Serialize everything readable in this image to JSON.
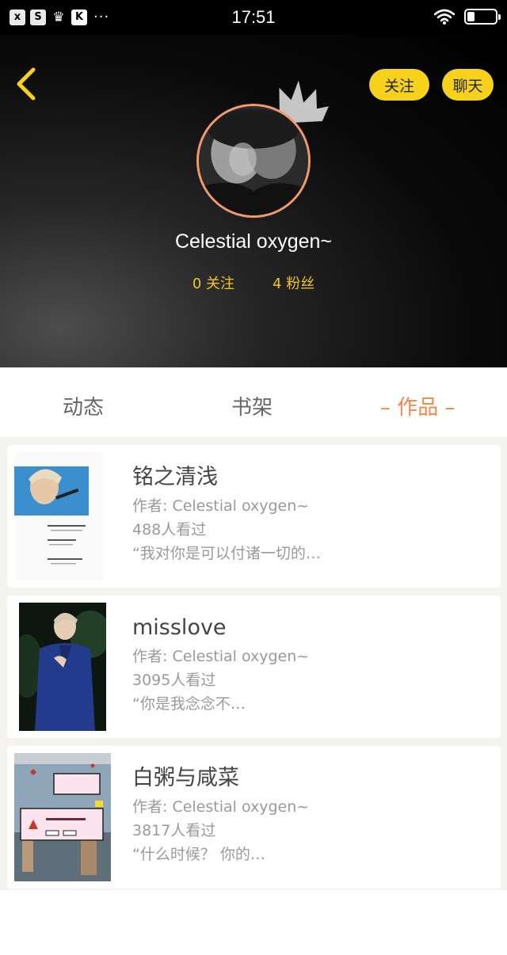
{
  "status_bar": {
    "time": "17:51",
    "left_icons": [
      "x-app-icon",
      "s-app-icon",
      "crown-app-icon",
      "k-app-icon"
    ],
    "more": "···",
    "battery_level": 0.25
  },
  "header": {
    "follow_label": "关注",
    "chat_label": "聊天",
    "username": "Celestial oxygen~",
    "following_count": "0",
    "following_label": "关注",
    "fans_count": "4",
    "fans_label": "粉丝",
    "accent_color": "#f7d21c",
    "avatar_border_color": "#f39a6b"
  },
  "tabs": [
    {
      "label": "动态"
    },
    {
      "label": "书架"
    },
    {
      "label": "– 作品 –",
      "active": true
    }
  ],
  "works": [
    {
      "title": "铭之清浅",
      "author": "作者: Celestial oxygen~",
      "views": "488人看过",
      "excerpt": "“我对你是可以付诸一切的…"
    },
    {
      "title": "misslove",
      "author": "作者: Celestial oxygen~",
      "views": "3095人看过",
      "excerpt": "“你是我念念不…"
    },
    {
      "title": "白粥与咸菜",
      "author": "作者: Celestial oxygen~",
      "views": "3817人看过",
      "excerpt": "“什么时候？ 你的…"
    }
  ]
}
